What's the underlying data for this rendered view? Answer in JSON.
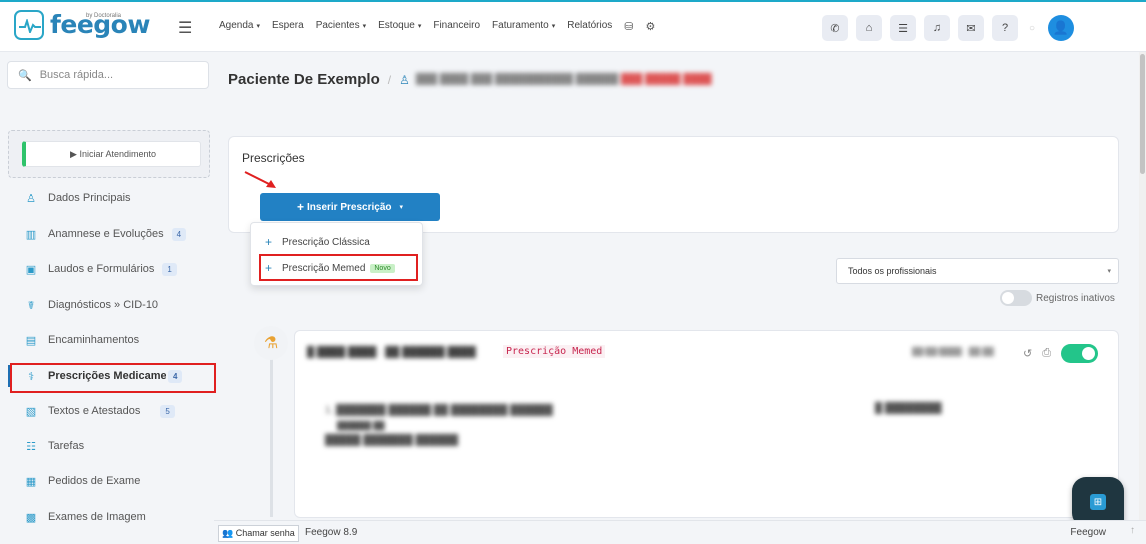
{
  "app": {
    "logo_text": "feegow",
    "logo_sub": "by Doctoralia"
  },
  "topmenu": {
    "items": [
      {
        "label": "Agenda",
        "dropdown": true
      },
      {
        "label": "Espera",
        "dropdown": false
      },
      {
        "label": "Pacientes",
        "dropdown": true
      },
      {
        "label": "Estoque",
        "dropdown": true
      },
      {
        "label": "Financeiro",
        "dropdown": false
      },
      {
        "label": "Faturamento",
        "dropdown": true
      },
      {
        "label": "Relatórios",
        "dropdown": false
      }
    ],
    "caret": "▾"
  },
  "sidebar": {
    "search_placeholder": "Busca rápida...",
    "start_button": "▶ Iniciar Atendimento",
    "items": [
      {
        "label": "Dados Principais",
        "badge": "",
        "icon": "person-icon"
      },
      {
        "label": "Anamnese e Evoluções",
        "badge": "4",
        "icon": "chart-icon"
      },
      {
        "label": "Laudos e Formulários",
        "badge": "1",
        "icon": "form-icon"
      },
      {
        "label": "Diagnósticos » CID-10",
        "badge": "",
        "icon": "stethoscope-icon"
      },
      {
        "label": "Encaminhamentos",
        "badge": "",
        "icon": "document-icon"
      },
      {
        "label": "Prescrições Medicamentosas",
        "badge": "4",
        "icon": "pills-icon"
      },
      {
        "label": "Textos e Atestados",
        "badge": "5",
        "icon": "text-icon"
      },
      {
        "label": "Tarefas",
        "badge": "",
        "icon": "tasks-icon"
      },
      {
        "label": "Pedidos de Exame",
        "badge": "",
        "icon": "clipboard-icon"
      },
      {
        "label": "Exames de Imagem",
        "badge": "",
        "icon": "image-icon"
      }
    ]
  },
  "breadcrumb": {
    "patient": "Paciente De Exemplo",
    "separator": "/"
  },
  "prescriptions": {
    "title": "Prescrições",
    "insert_button": "Inserir Prescrição",
    "menu": [
      {
        "label": "Prescrição Clássica",
        "badge": ""
      },
      {
        "label": "Prescrição Memed",
        "badge": "Novo"
      }
    ]
  },
  "filters": {
    "professional_select": "Todos os profissionais",
    "inactive_label": "Registros inativos"
  },
  "entry": {
    "tag": "Prescrição Memed"
  },
  "footer": {
    "call_button": "Chamar senha",
    "version": "Feegow 8.9",
    "brand": "Feegow"
  }
}
